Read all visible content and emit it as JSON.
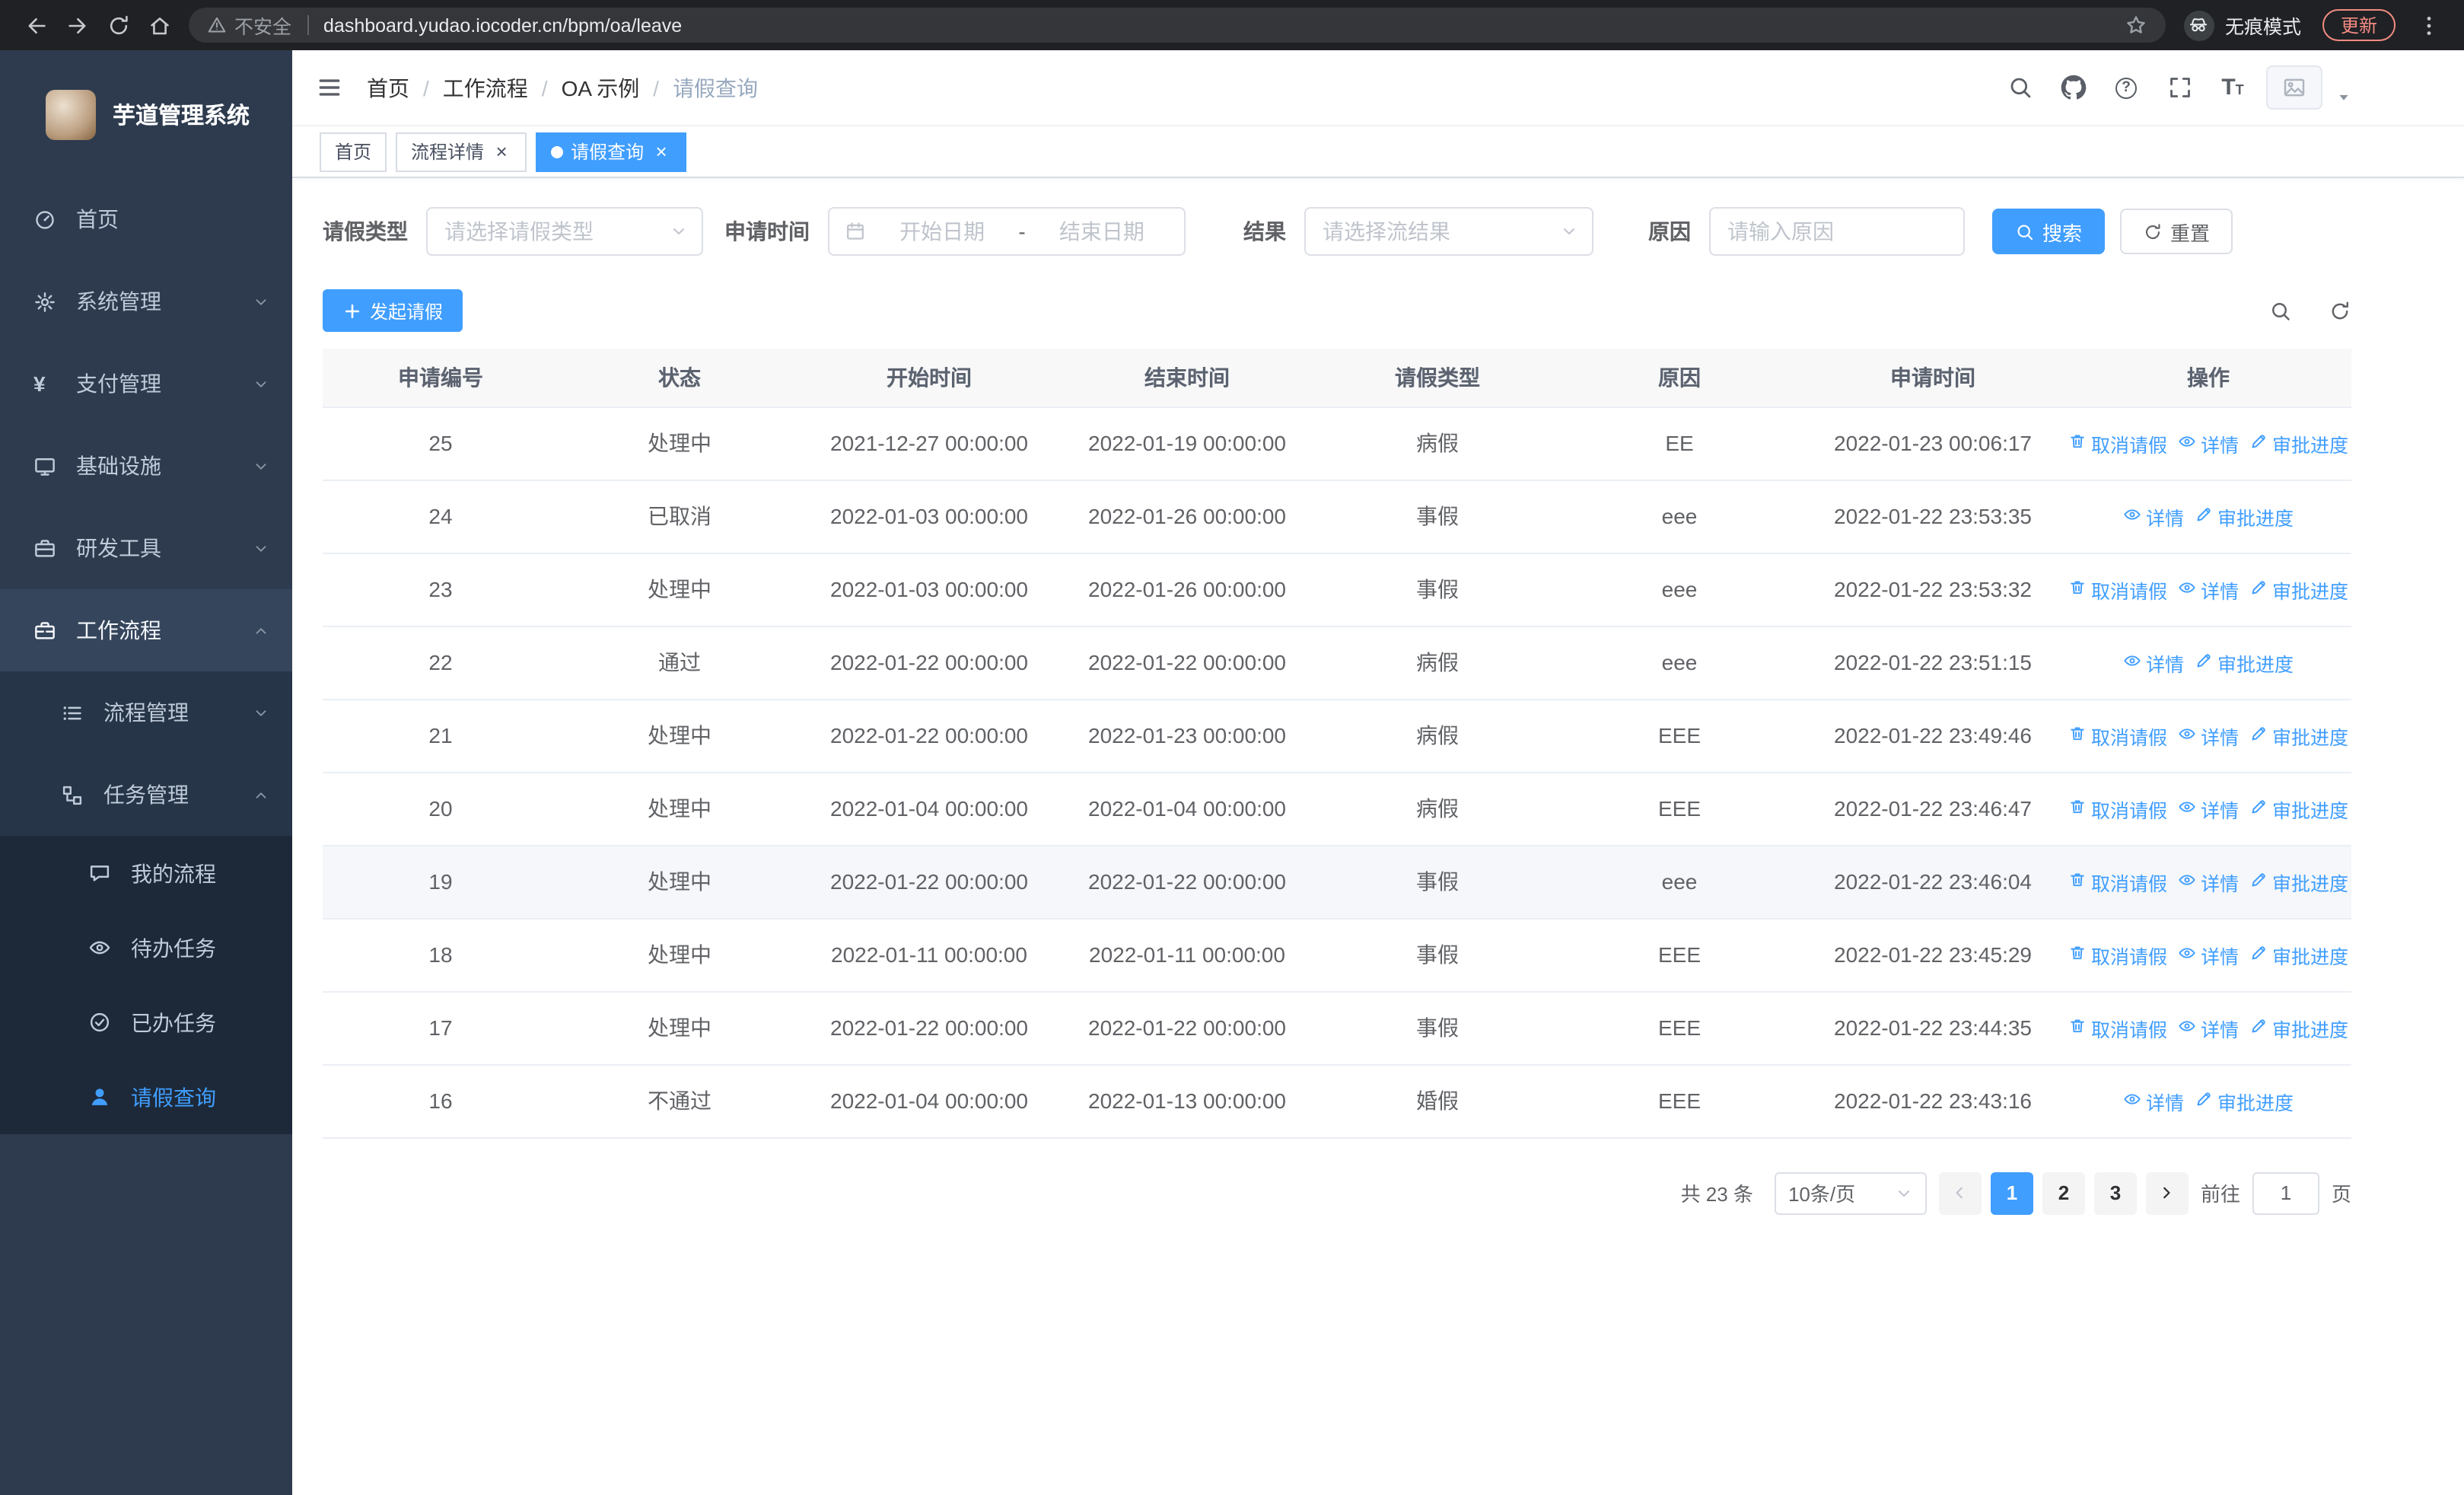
{
  "colors": {
    "accent": "#409eff",
    "sidebar_bg": "#2e3b4e",
    "update_chip": "#f28b82",
    "link": "#409eff"
  },
  "browser": {
    "security_label": "不安全",
    "url": "dashboard.yudao.iocoder.cn/bpm/oa/leave",
    "incognito_label": "无痕模式",
    "update_label": "更新"
  },
  "sidebar": {
    "logo_title": "芋道管理系统",
    "items": [
      {
        "key": "home",
        "label": "首页",
        "icon": "dashboard-icon",
        "level": 1
      },
      {
        "key": "system",
        "label": "系统管理",
        "icon": "gear-icon",
        "level": 1,
        "chevron": "down"
      },
      {
        "key": "payment",
        "label": "支付管理",
        "icon": "yen-icon",
        "level": 1,
        "chevron": "down"
      },
      {
        "key": "infrastructure",
        "label": "基础设施",
        "icon": "monitor-icon",
        "level": 1,
        "chevron": "down"
      },
      {
        "key": "dev-tools",
        "label": "研发工具",
        "icon": "toolbox-icon",
        "level": 1,
        "chevron": "down"
      },
      {
        "key": "workflow",
        "label": "工作流程",
        "icon": "briefcase-icon",
        "level": 1,
        "chevron": "up",
        "parent_active": true
      },
      {
        "key": "process-management",
        "label": "流程管理",
        "icon": "list-icon",
        "level": 2,
        "chevron": "down"
      },
      {
        "key": "task-management",
        "label": "任务管理",
        "icon": "nodes-icon",
        "level": 2,
        "chevron": "up"
      },
      {
        "key": "my-process",
        "label": "我的流程",
        "icon": "chat-icon",
        "level": 3
      },
      {
        "key": "todo-tasks",
        "label": "待办任务",
        "icon": "eye-icon",
        "level": 3
      },
      {
        "key": "done-tasks",
        "label": "已办任务",
        "icon": "check-icon",
        "level": 3
      },
      {
        "key": "leave-query",
        "label": "请假查询",
        "icon": "user-icon",
        "level": 3,
        "active": true
      }
    ]
  },
  "header": {
    "breadcrumb": [
      "首页",
      "工作流程",
      "OA 示例",
      "请假查询"
    ],
    "tools": [
      "search-icon",
      "github-icon",
      "help-icon",
      "fullscreen-icon",
      "font-size-icon"
    ]
  },
  "tabs": [
    {
      "key": "home",
      "label": "首页",
      "active": false,
      "closable": false
    },
    {
      "key": "process-detail",
      "label": "流程详情",
      "active": false,
      "closable": true
    },
    {
      "key": "leave-query",
      "label": "请假查询",
      "active": true,
      "closable": true
    }
  ],
  "filters": {
    "leave_type_label": "请假类型",
    "leave_type_placeholder": "请选择请假类型",
    "apply_time_label": "申请时间",
    "start_date_placeholder": "开始日期",
    "range_separator": "-",
    "end_date_placeholder": "结束日期",
    "result_label": "结果",
    "result_placeholder": "请选择流结果",
    "reason_label": "原因",
    "reason_placeholder": "请输入原因",
    "search_label": "搜索",
    "reset_label": "重置"
  },
  "toolbar": {
    "create_label": "发起请假"
  },
  "table": {
    "columns": [
      "申请编号",
      "状态",
      "开始时间",
      "结束时间",
      "请假类型",
      "原因",
      "申请时间",
      "操作"
    ],
    "action_labels": {
      "cancel": "取消请假",
      "detail": "详情",
      "progress": "审批进度"
    },
    "rows": [
      {
        "id": "25",
        "status": "处理中",
        "start_time": "2021-12-27 00:00:00",
        "end_time": "2022-01-19 00:00:00",
        "leave_type": "病假",
        "reason": "EE",
        "apply_time": "2022-01-23 00:06:17",
        "actions": [
          "cancel",
          "detail",
          "progress"
        ]
      },
      {
        "id": "24",
        "status": "已取消",
        "start_time": "2022-01-03 00:00:00",
        "end_time": "2022-01-26 00:00:00",
        "leave_type": "事假",
        "reason": "eee",
        "apply_time": "2022-01-22 23:53:35",
        "actions": [
          "detail",
          "progress"
        ]
      },
      {
        "id": "23",
        "status": "处理中",
        "start_time": "2022-01-03 00:00:00",
        "end_time": "2022-01-26 00:00:00",
        "leave_type": "事假",
        "reason": "eee",
        "apply_time": "2022-01-22 23:53:32",
        "actions": [
          "cancel",
          "detail",
          "progress"
        ]
      },
      {
        "id": "22",
        "status": "通过",
        "start_time": "2022-01-22 00:00:00",
        "end_time": "2022-01-22 00:00:00",
        "leave_type": "病假",
        "reason": "eee",
        "apply_time": "2022-01-22 23:51:15",
        "actions": [
          "detail",
          "progress"
        ]
      },
      {
        "id": "21",
        "status": "处理中",
        "start_time": "2022-01-22 00:00:00",
        "end_time": "2022-01-23 00:00:00",
        "leave_type": "病假",
        "reason": "EEE",
        "apply_time": "2022-01-22 23:49:46",
        "actions": [
          "cancel",
          "detail",
          "progress"
        ]
      },
      {
        "id": "20",
        "status": "处理中",
        "start_time": "2022-01-04 00:00:00",
        "end_time": "2022-01-04 00:00:00",
        "leave_type": "病假",
        "reason": "EEE",
        "apply_time": "2022-01-22 23:46:47",
        "actions": [
          "cancel",
          "detail",
          "progress"
        ]
      },
      {
        "id": "19",
        "status": "处理中",
        "start_time": "2022-01-22 00:00:00",
        "end_time": "2022-01-22 00:00:00",
        "leave_type": "事假",
        "reason": "eee",
        "apply_time": "2022-01-22 23:46:04",
        "actions": [
          "cancel",
          "detail",
          "progress"
        ],
        "highlight": true
      },
      {
        "id": "18",
        "status": "处理中",
        "start_time": "2022-01-11 00:00:00",
        "end_time": "2022-01-11 00:00:00",
        "leave_type": "事假",
        "reason": "EEE",
        "apply_time": "2022-01-22 23:45:29",
        "actions": [
          "cancel",
          "detail",
          "progress"
        ]
      },
      {
        "id": "17",
        "status": "处理中",
        "start_time": "2022-01-22 00:00:00",
        "end_time": "2022-01-22 00:00:00",
        "leave_type": "事假",
        "reason": "EEE",
        "apply_time": "2022-01-22 23:44:35",
        "actions": [
          "cancel",
          "detail",
          "progress"
        ]
      },
      {
        "id": "16",
        "status": "不通过",
        "start_time": "2022-01-04 00:00:00",
        "end_time": "2022-01-13 00:00:00",
        "leave_type": "婚假",
        "reason": "EEE",
        "apply_time": "2022-01-22 23:43:16",
        "actions": [
          "detail",
          "progress"
        ]
      }
    ]
  },
  "pagination": {
    "total_label": "共 23 条",
    "page_size_label": "10条/页",
    "pages": [
      "1",
      "2",
      "3"
    ],
    "active_page": "1",
    "prev_disabled": true,
    "goto_label": "前往",
    "goto_value": "1",
    "goto_suffix": "页"
  }
}
